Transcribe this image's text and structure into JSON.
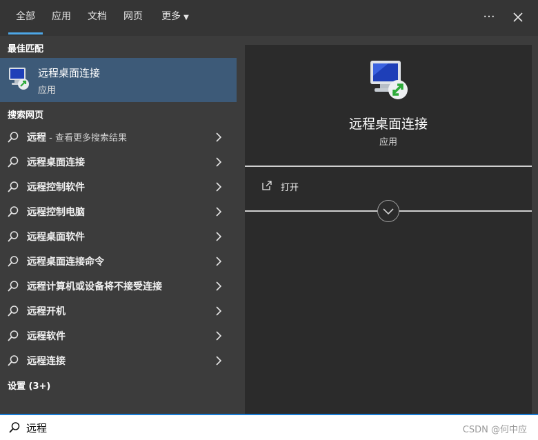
{
  "tabs": [
    {
      "label": "全部",
      "active": true
    },
    {
      "label": "应用"
    },
    {
      "label": "文档"
    },
    {
      "label": "网页"
    },
    {
      "label": "更多"
    }
  ],
  "top_buttons": {
    "more_icon": "ellipsis-icon",
    "close_icon": "close-icon"
  },
  "left": {
    "best_match_title": "最佳匹配",
    "best_match": {
      "name": "远程桌面连接",
      "type": "应用",
      "icon": "remote-desktop-icon"
    },
    "web_search_title": "搜索网页",
    "suggestions": [
      {
        "label": "远程",
        "extra": " - 查看更多搜索结果"
      },
      {
        "label": "远程桌面连接"
      },
      {
        "label": "远程控制软件"
      },
      {
        "label": "远程控制电脑"
      },
      {
        "label": "远程桌面软件"
      },
      {
        "label": "远程桌面连接命令"
      },
      {
        "label": "远程计算机或设备将不接受连接"
      },
      {
        "label": "远程开机"
      },
      {
        "label": "远程软件"
      },
      {
        "label": "远程连接"
      }
    ],
    "settings_title": "设置 (3+)"
  },
  "right": {
    "app_name": "远程桌面连接",
    "app_type": "应用",
    "actions": [
      {
        "label": "打开",
        "icon": "open-icon"
      }
    ]
  },
  "search": {
    "value": "远程"
  },
  "watermark": "CSDN @何中应",
  "colors": {
    "accent": "#4da6e6",
    "selected_bg": "#3d5a78",
    "search_border": "#1a7dd6"
  }
}
